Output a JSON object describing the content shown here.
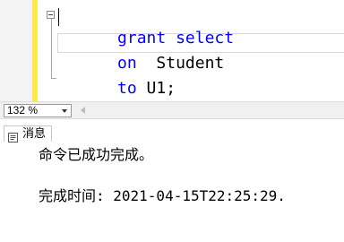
{
  "editor": {
    "lines": [
      [
        {
          "text": "grant",
          "kind": "kw"
        },
        {
          "text": " ",
          "kind": "plain"
        },
        {
          "text": "select",
          "kind": "kw"
        }
      ],
      [
        {
          "text": "on",
          "kind": "kw"
        },
        {
          "text": "  Student",
          "kind": "plain"
        }
      ],
      [
        {
          "text": "to",
          "kind": "kw"
        },
        {
          "text": " U1;",
          "kind": "plain"
        }
      ]
    ],
    "keyword_color": "#0000ff",
    "change_bar_color": "#ffe84a"
  },
  "zoom": {
    "value": "132 %"
  },
  "results": {
    "tab_label": "消息",
    "tab_icon": "message-icon",
    "messages": [
      "命令已成功完成。",
      "完成时间: 2021-04-15T22:25:29."
    ]
  }
}
